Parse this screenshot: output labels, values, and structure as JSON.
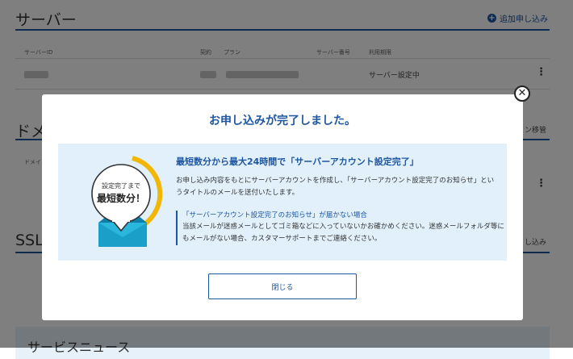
{
  "background": {
    "server_section": {
      "title": "サーバー",
      "add_label": "追加申し込み",
      "columns": [
        "サーバーID",
        "契約",
        "プラン",
        "サーバー番号",
        "利用期限"
      ],
      "row_status": "サーバー設定中"
    },
    "domain_section": {
      "title_partial": "ドメ",
      "column_partial": "ドメイ",
      "action_partial": "ン移管"
    },
    "ssl_section": {
      "title_partial": "SSL",
      "add_partial": "し込み"
    },
    "news_title": "サービスニュース"
  },
  "modal": {
    "title": "お申し込みが完了しました。",
    "badge": {
      "line1": "設定完了まで",
      "line2": "最短数分！"
    },
    "headline": "最短数分から最大24時間で「サーバーアカウント設定完了」",
    "body": "お申し込み内容をもとにサーバーアカウントを作成し、「サーバーアカウント設定完了のお知らせ」というタイトルのメールを送付いたします。",
    "note": {
      "title": "「サーバーアカウント設定完了のお知らせ」が届かない場合",
      "body": "当該メールが迷惑メールとしてゴミ箱などに入っていないかお確かめください。迷惑メールフォルダ等にもメールがない場合、カスタマーサポートまでご連絡ください。"
    },
    "close_label": "閉じる",
    "close_icon": "close-icon"
  },
  "colors": {
    "accent": "#1e56a0",
    "info_bg": "#e1f0fb",
    "overlay": "rgba(0,0,0,0.5)",
    "badge_arrow": "#f2b705",
    "envelope": "#1aa0c8"
  }
}
